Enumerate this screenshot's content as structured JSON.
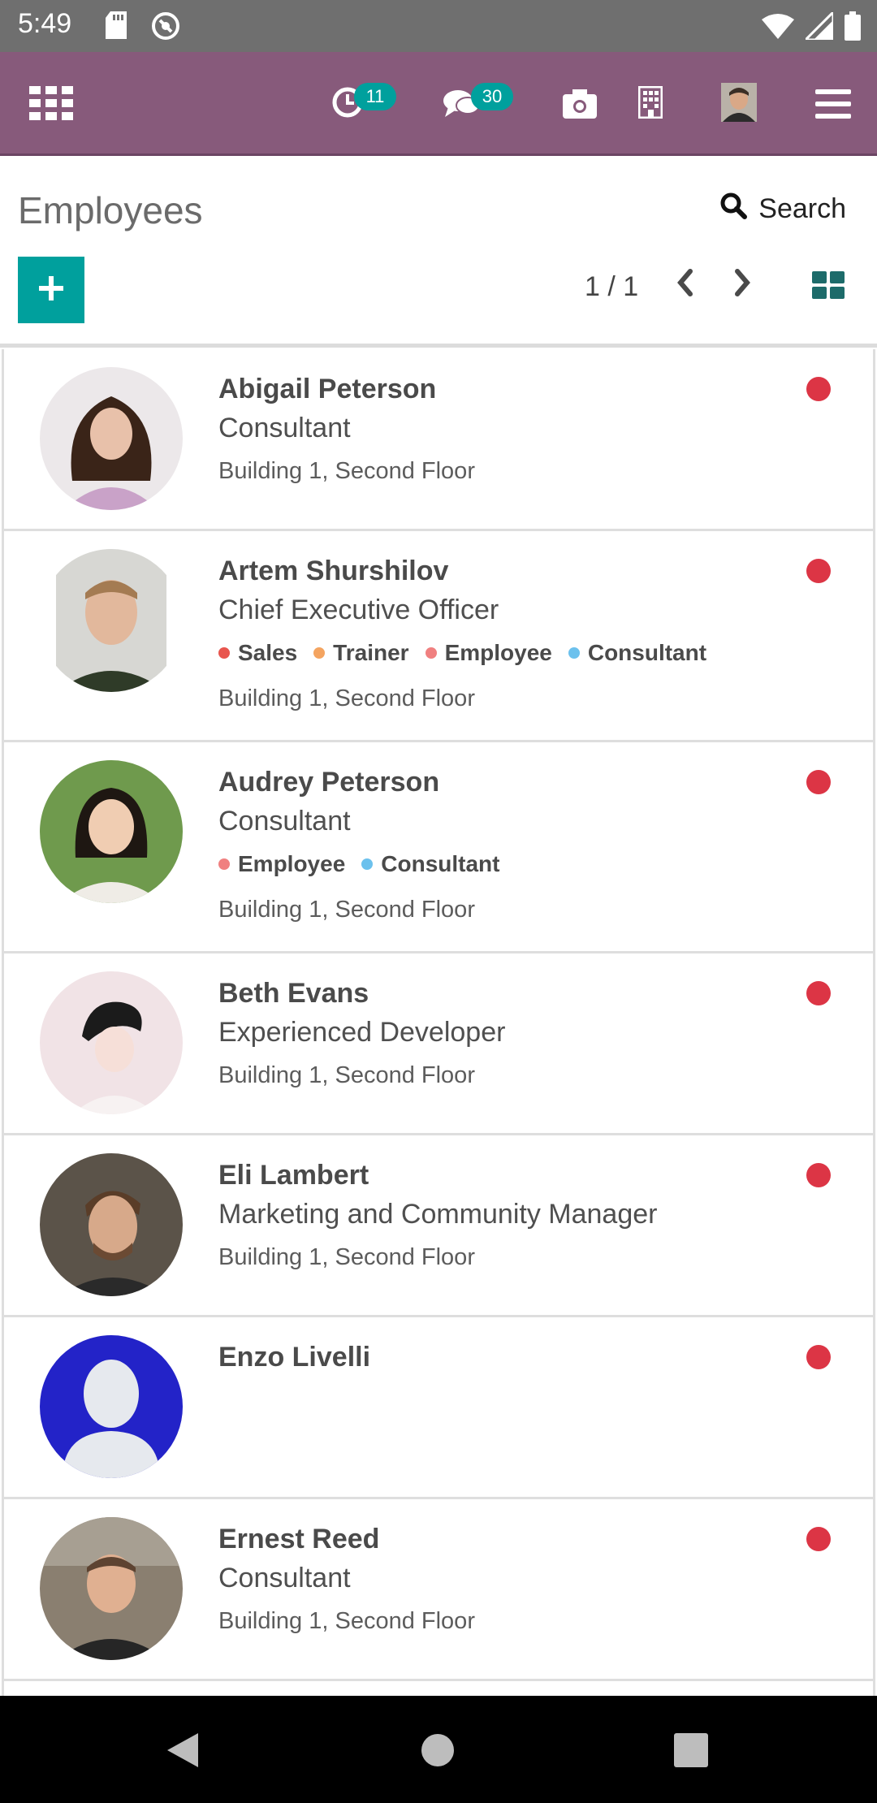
{
  "status_bar": {
    "time": "5:49"
  },
  "appbar": {
    "activity_count": "11",
    "messages_count": "30",
    "icons": [
      "apps-grid-icon",
      "activity-clock-icon",
      "chat-icon",
      "camera-icon",
      "company-building-icon",
      "user-avatar",
      "hamburger-menu-icon"
    ]
  },
  "control_panel": {
    "title": "Employees",
    "search_label": "Search",
    "pager": "1 / 1"
  },
  "colors": {
    "brand": "#875a7b",
    "accent": "#00a09d",
    "presence_absent": "#dc3545"
  },
  "employees": [
    {
      "name": "Abigail Peterson",
      "job": "Consultant",
      "tags": [],
      "location": "Building 1, Second Floor"
    },
    {
      "name": "Artem Shurshilov",
      "job": "Chief Executive Officer",
      "tags": [
        {
          "label": "Sales",
          "color": "#e8554e"
        },
        {
          "label": "Trainer",
          "color": "#f4a460"
        },
        {
          "label": "Employee",
          "color": "#f08080"
        },
        {
          "label": "Consultant",
          "color": "#6cc1ed"
        }
      ],
      "location": "Building 1, Second Floor"
    },
    {
      "name": "Audrey Peterson",
      "job": "Consultant",
      "tags": [
        {
          "label": "Employee",
          "color": "#f08080"
        },
        {
          "label": "Consultant",
          "color": "#6cc1ed"
        }
      ],
      "location": "Building 1, Second Floor"
    },
    {
      "name": "Beth Evans",
      "job": "Experienced Developer",
      "tags": [],
      "location": "Building 1, Second Floor"
    },
    {
      "name": "Eli Lambert",
      "job": "Marketing and Community Manager",
      "tags": [],
      "location": "Building 1, Second Floor"
    },
    {
      "name": "Enzo Livelli",
      "job": "",
      "tags": [],
      "location": ""
    },
    {
      "name": "Ernest Reed",
      "job": "Consultant",
      "tags": [],
      "location": "Building 1, Second Floor"
    }
  ]
}
